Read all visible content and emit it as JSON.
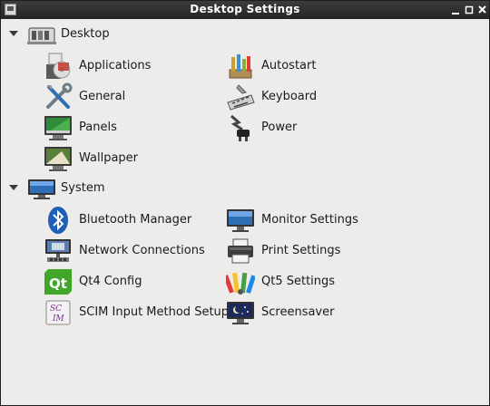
{
  "window": {
    "title": "Desktop Settings",
    "controls": [
      "minimize",
      "maximize",
      "close"
    ]
  },
  "sections": [
    {
      "label": "Desktop",
      "icon": "desktop-icon",
      "items": [
        {
          "label": "Applications",
          "icon": "applications-icon"
        },
        {
          "label": "Autostart",
          "icon": "autostart-icon"
        },
        {
          "label": "General",
          "icon": "general-tools-icon"
        },
        {
          "label": "Keyboard",
          "icon": "keyboard-icon"
        },
        {
          "label": "Panels",
          "icon": "panels-icon"
        },
        {
          "label": "Power",
          "icon": "power-icon"
        },
        {
          "label": "Wallpaper",
          "icon": "wallpaper-icon"
        }
      ]
    },
    {
      "label": "System",
      "icon": "system-monitor-icon",
      "items": [
        {
          "label": "Bluetooth Manager",
          "icon": "bluetooth-icon"
        },
        {
          "label": "Monitor Settings",
          "icon": "monitor-icon"
        },
        {
          "label": "Network Connections",
          "icon": "network-icon"
        },
        {
          "label": "Print Settings",
          "icon": "printer-icon"
        },
        {
          "label": "Qt4 Config",
          "icon": "qt-icon"
        },
        {
          "label": "Qt5 Settings",
          "icon": "qt5-settings-icon"
        },
        {
          "label": "SCIM Input Method Setup",
          "icon": "scim-icon"
        },
        {
          "label": "Screensaver",
          "icon": "screensaver-icon"
        }
      ]
    }
  ]
}
